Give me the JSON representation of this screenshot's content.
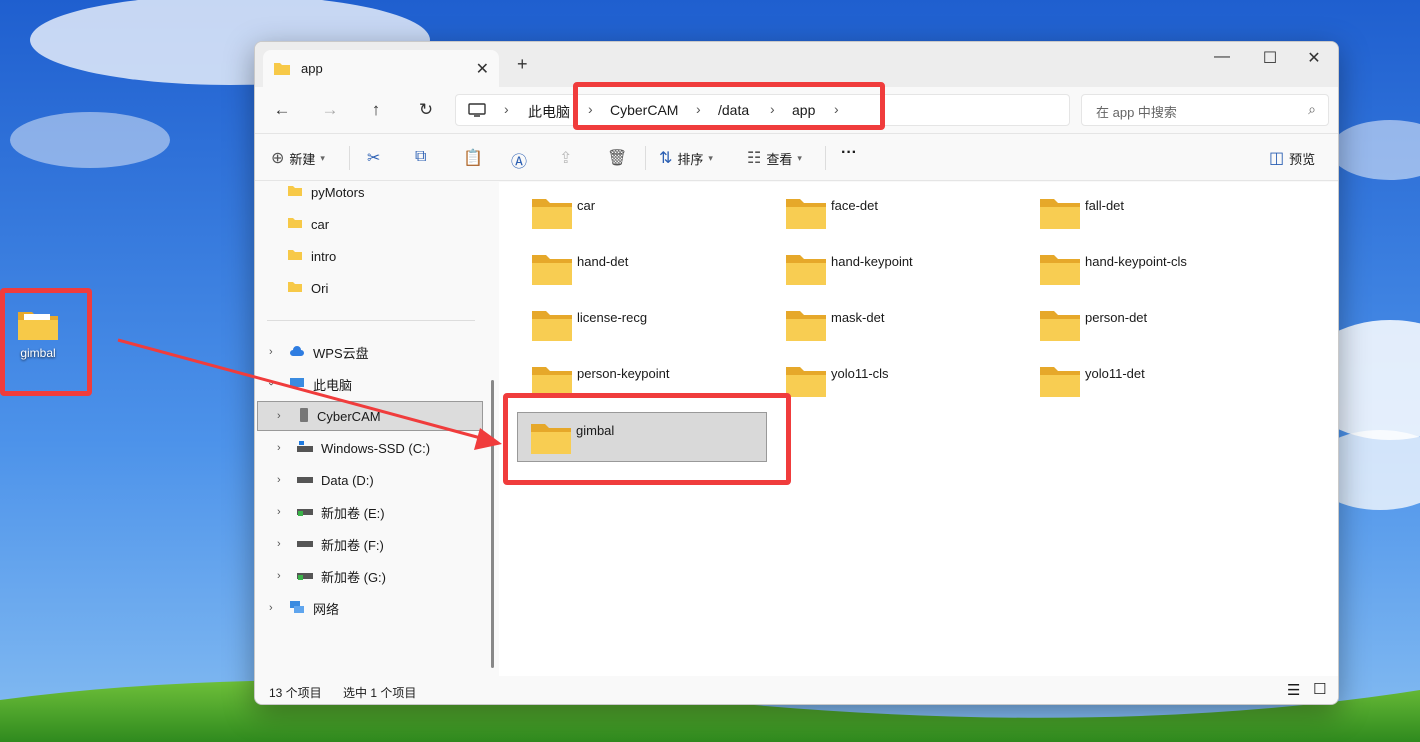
{
  "desktop": {
    "icon_label": "gimbal"
  },
  "window": {
    "tab_title": "app",
    "new_tab": "+",
    "controls": {
      "minimize": "—",
      "maximize": "☐",
      "close": "✕"
    }
  },
  "nav": {
    "back": "←",
    "forward": "→",
    "up": "↑",
    "refresh": "↻",
    "breadcrumb": [
      "此电脑",
      "CyberCAM",
      "/data",
      "app"
    ],
    "search_placeholder": "在 app 中搜索"
  },
  "toolbar": {
    "new_label": "新建",
    "sort_label": "排序",
    "view_label": "查看",
    "more_label": "···",
    "preview_label": "预览"
  },
  "sidebar": {
    "folders": [
      "pyMotors",
      "car",
      "intro",
      "Ori"
    ],
    "cloud": "WPS云盘",
    "this_pc": "此电脑",
    "drives": [
      "CyberCAM",
      "Windows-SSD (C:)",
      "Data (D:)",
      "新加卷 (E:)",
      "新加卷 (F:)",
      "新加卷 (G:)"
    ],
    "network": "网络"
  },
  "content": {
    "items": [
      "car",
      "face-det",
      "fall-det",
      "hand-det",
      "hand-keypoint",
      "hand-keypoint-cls",
      "license-recg",
      "mask-det",
      "person-det",
      "person-keypoint",
      "yolo11-cls",
      "yolo11-det",
      "gimbal"
    ],
    "selected": "gimbal"
  },
  "status": {
    "count": "13 个项目",
    "selection": "选中 1 个项目"
  },
  "colors": {
    "highlight": "#f03c3c",
    "accent": "#2b5fb3",
    "folder": "#f7c948"
  }
}
